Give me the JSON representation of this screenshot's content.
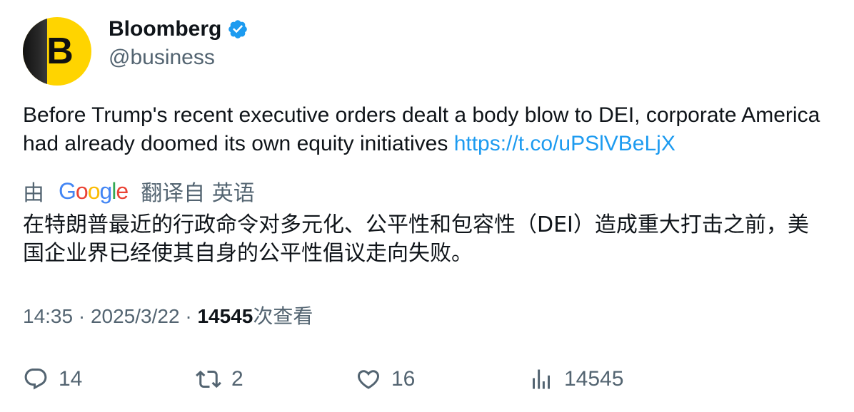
{
  "author": {
    "display_name": "Bloomberg",
    "handle": "@business",
    "avatar_letter": "B",
    "verified": true,
    "verified_color": "#1d9bf0",
    "avatar_color": "#ffd400"
  },
  "tweet": {
    "text": "Before Trump's recent executive orders dealt a body blow to DEI, corporate America had already doomed its own equity initiatives ",
    "link": "https://t.co/uPSlVBeLjX",
    "link_color": "#1d9bf0"
  },
  "translation": {
    "prefix": "由",
    "provider": "Google",
    "suffix": "翻译自 英语",
    "text": "在特朗普最近的行政命令对多元化、公平性和包容性（DEI）造成重大打击之前，美国企业界已经使其自身的公平性倡议走向失败。"
  },
  "meta": {
    "time": "14:35",
    "separator": "·",
    "date": "2025/3/22",
    "views": "14545",
    "views_label": "次查看"
  },
  "actions": {
    "reply": {
      "icon": "reply-icon",
      "count": "14"
    },
    "retweet": {
      "icon": "retweet-icon",
      "count": "2"
    },
    "like": {
      "icon": "heart-icon",
      "count": "16"
    },
    "views": {
      "icon": "analytics-icon",
      "count": "14545"
    }
  }
}
